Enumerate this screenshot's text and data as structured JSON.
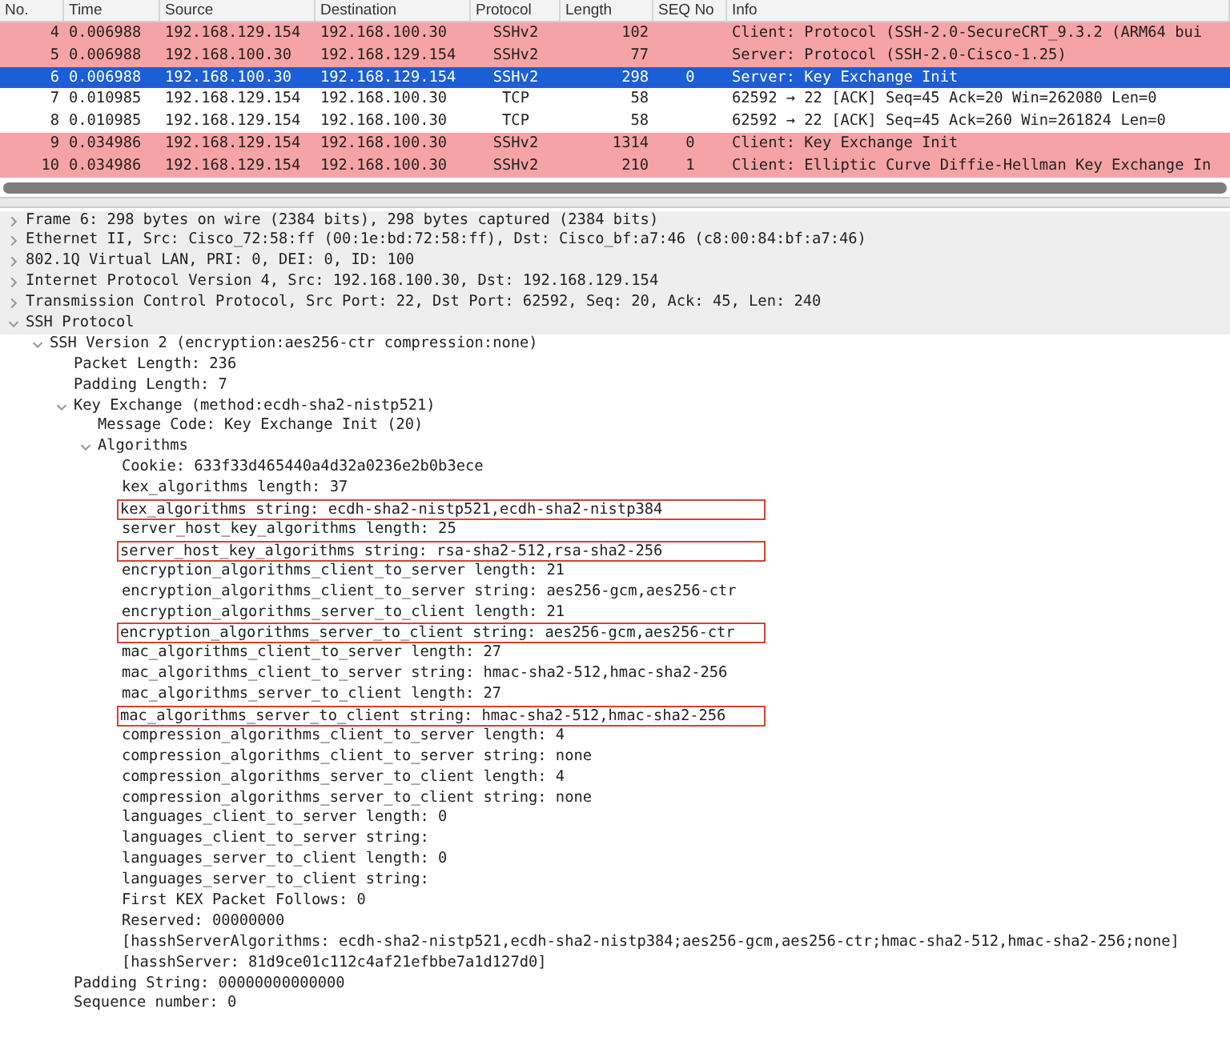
{
  "packet_list": {
    "columns": [
      "No.",
      "Time",
      "Source",
      "Destination",
      "Protocol",
      "Length",
      "SEQ No",
      "Info"
    ],
    "rows": [
      {
        "no": "4",
        "time": "0.006988",
        "source": "192.168.129.154",
        "destination": "192.168.100.30",
        "protocol": "SSHv2",
        "length": "102",
        "seq": "",
        "info": "Client: Protocol (SSH-2.0-SecureCRT_9.3.2 (ARM64 bui",
        "color": "#f6a3a6",
        "selected": false
      },
      {
        "no": "5",
        "time": "0.006988",
        "source": "192.168.100.30",
        "destination": "192.168.129.154",
        "protocol": "SSHv2",
        "length": "77",
        "seq": "",
        "info": "Server: Protocol (SSH-2.0-Cisco-1.25)",
        "color": "#f6a3a6",
        "selected": false
      },
      {
        "no": "6",
        "time": "0.006988",
        "source": "192.168.100.30",
        "destination": "192.168.129.154",
        "protocol": "SSHv2",
        "length": "298",
        "seq": "0",
        "info": "Server: Key Exchange Init",
        "selected": true
      },
      {
        "no": "7",
        "time": "0.010985",
        "source": "192.168.129.154",
        "destination": "192.168.100.30",
        "protocol": "TCP",
        "length": "58",
        "seq": "",
        "info": "62592 → 22 [ACK] Seq=45 Ack=20 Win=262080 Len=0",
        "color": "#ffffff",
        "selected": false
      },
      {
        "no": "8",
        "time": "0.010985",
        "source": "192.168.129.154",
        "destination": "192.168.100.30",
        "protocol": "TCP",
        "length": "58",
        "seq": "",
        "info": "62592 → 22 [ACK] Seq=45 Ack=260 Win=261824 Len=0",
        "color": "#ffffff",
        "selected": false
      },
      {
        "no": "9",
        "time": "0.034986",
        "source": "192.168.129.154",
        "destination": "192.168.100.30",
        "protocol": "SSHv2",
        "length": "1314",
        "seq": "0",
        "info": "Client: Key Exchange Init",
        "color": "#f6a3a6",
        "selected": false
      },
      {
        "no": "10",
        "time": "0.034986",
        "source": "192.168.129.154",
        "destination": "192.168.100.30",
        "protocol": "SSHv2",
        "length": "210",
        "seq": "1",
        "info": "Client: Elliptic Curve Diffie-Hellman Key Exchange In",
        "color": "#f6a3a6",
        "selected": false
      }
    ]
  },
  "packet_details": [
    {
      "text": "Frame 6: 298 bytes on wire (2384 bits), 298 bytes captured (2384 bits)",
      "expanded": false
    },
    {
      "text": "Ethernet II, Src: Cisco_72:58:ff (00:1e:bd:72:58:ff), Dst: Cisco_bf:a7:46 (c8:00:84:bf:a7:46)",
      "expanded": false
    },
    {
      "text": "802.1Q Virtual LAN, PRI: 0, DEI: 0, ID: 100",
      "expanded": false
    },
    {
      "text": "Internet Protocol Version 4, Src: 192.168.100.30, Dst: 192.168.129.154",
      "expanded": false
    },
    {
      "text": "Transmission Control Protocol, Src Port: 22, Dst Port: 62592, Seq: 20, Ack: 45, Len: 240",
      "expanded": false
    },
    {
      "text": "SSH Protocol",
      "expanded": true,
      "children": [
        {
          "text": "SSH Version 2 (encryption:aes256-ctr compression:none)",
          "expanded": true,
          "children": [
            {
              "text": "Packet Length: 236"
            },
            {
              "text": "Padding Length: 7"
            },
            {
              "text": "Key Exchange (method:ecdh-sha2-nistp521)",
              "expanded": true,
              "children": [
                {
                  "text": "Message Code: Key Exchange Init (20)"
                },
                {
                  "text": "Algorithms",
                  "expanded": true,
                  "children": [
                    {
                      "text": "Cookie: 633f33d465440a4d32a0236e2b0b3ece",
                      "boxed": false
                    },
                    {
                      "text": "kex_algorithms length: 37",
                      "boxed": false
                    },
                    {
                      "text": "kex_algorithms string: ecdh-sha2-nistp521,ecdh-sha2-nistp384",
                      "boxed": true
                    },
                    {
                      "text": "server_host_key_algorithms length: 25",
                      "boxed": false
                    },
                    {
                      "text": "server_host_key_algorithms string: rsa-sha2-512,rsa-sha2-256",
                      "boxed": true
                    },
                    {
                      "text": "encryption_algorithms_client_to_server length: 21",
                      "boxed": false
                    },
                    {
                      "text": "encryption_algorithms_client_to_server string: aes256-gcm,aes256-ctr",
                      "boxed": false
                    },
                    {
                      "text": "encryption_algorithms_server_to_client length: 21",
                      "boxed": false
                    },
                    {
                      "text": "encryption_algorithms_server_to_client string: aes256-gcm,aes256-ctr",
                      "boxed": true
                    },
                    {
                      "text": "mac_algorithms_client_to_server length: 27",
                      "boxed": false
                    },
                    {
                      "text": "mac_algorithms_client_to_server string: hmac-sha2-512,hmac-sha2-256",
                      "boxed": false
                    },
                    {
                      "text": "mac_algorithms_server_to_client length: 27",
                      "boxed": false
                    },
                    {
                      "text": "mac_algorithms_server_to_client string: hmac-sha2-512,hmac-sha2-256",
                      "boxed": true
                    },
                    {
                      "text": "compression_algorithms_client_to_server length: 4",
                      "boxed": false
                    },
                    {
                      "text": "compression_algorithms_client_to_server string: none",
                      "boxed": false
                    },
                    {
                      "text": "compression_algorithms_server_to_client length: 4",
                      "boxed": false
                    },
                    {
                      "text": "compression_algorithms_server_to_client string: none",
                      "boxed": false
                    },
                    {
                      "text": "languages_client_to_server length: 0",
                      "boxed": false
                    },
                    {
                      "text": "languages_client_to_server string:",
                      "boxed": false
                    },
                    {
                      "text": "languages_server_to_client length: 0",
                      "boxed": false
                    },
                    {
                      "text": "languages_server_to_client string:",
                      "boxed": false
                    },
                    {
                      "text": "First KEX Packet Follows: 0",
                      "boxed": false
                    },
                    {
                      "text": "Reserved: 00000000",
                      "boxed": false
                    },
                    {
                      "text": "[hasshServerAlgorithms: ecdh-sha2-nistp521,ecdh-sha2-nistp384;aes256-gcm,aes256-ctr;hmac-sha2-512,hmac-sha2-256;none]",
                      "boxed": false
                    },
                    {
                      "text": "[hasshServer: 81d9ce01c112c4af21efbbe7a1d127d0]",
                      "boxed": false
                    }
                  ]
                }
              ]
            },
            {
              "text": "Padding String: 00000000000000"
            },
            {
              "text": "Sequence number: 0"
            }
          ]
        }
      ]
    }
  ]
}
